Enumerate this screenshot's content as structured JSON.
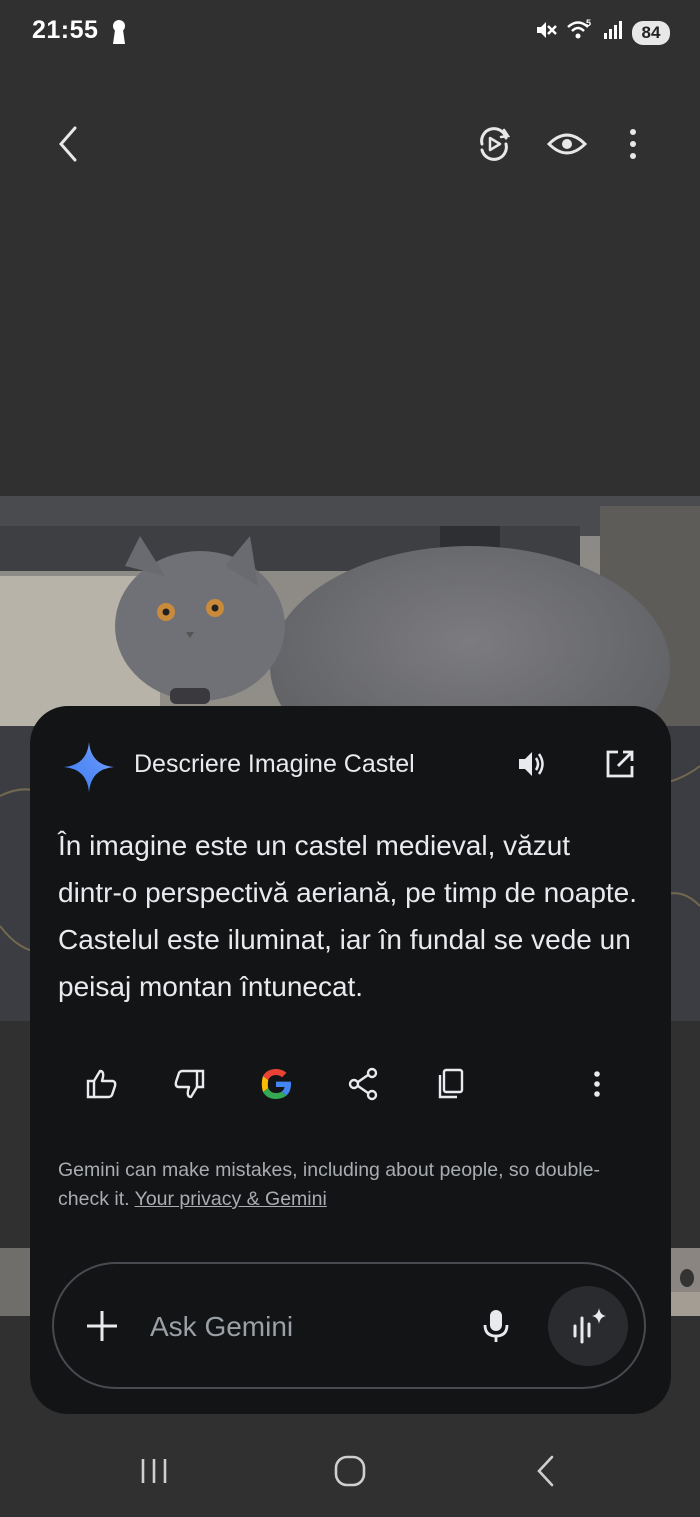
{
  "status_bar": {
    "time": "21:55",
    "battery": "84",
    "icons": [
      "keyhole-lock-icon",
      "mute-icon",
      "wifi-5-icon",
      "signal-icon"
    ]
  },
  "gallery_toolbar": {
    "icons": [
      "back-icon",
      "remaster-play-icon",
      "eye-icon",
      "more-vert-icon"
    ]
  },
  "gemini_card": {
    "title": "Descriere Imagine Castel",
    "answer": "În imagine este un castel medieval, văzut dintr-o perspectivă aeriană, pe timp de noapte. Castelul este iluminat, iar în fundal se vede un peisaj montan întunecat.",
    "actions": [
      "thumbs-up-icon",
      "thumbs-down-icon",
      "google-icon",
      "share-icon",
      "copy-icon",
      "more-vert-icon"
    ],
    "disclaimer": "Gemini can make mistakes, including about people, so double-check it.",
    "privacy_link": "Your privacy & Gemini",
    "input_placeholder": "Ask Gemini",
    "input_value": ""
  },
  "nav_bar": {
    "icons": [
      "recents-icon",
      "home-icon",
      "back-icon"
    ]
  },
  "colors": {
    "background": "#303030",
    "card": "#131416",
    "text": "#e8eaed",
    "muted": "#a9acb0",
    "spark_blue": "#4c8df6"
  }
}
